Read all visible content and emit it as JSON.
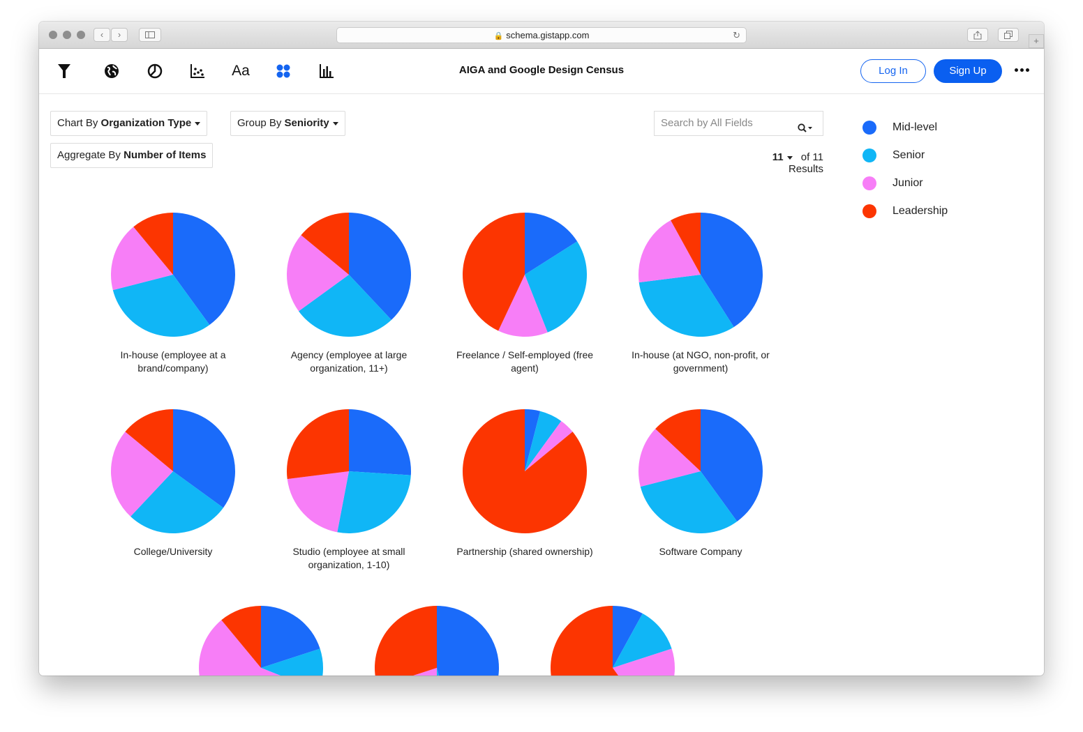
{
  "browser": {
    "url": "schema.gistapp.com"
  },
  "toolbar": {
    "icons": [
      "filter-icon",
      "globe-icon",
      "pie-chart-icon",
      "scatter-icon",
      "text-icon",
      "grid-icon",
      "bar-chart-icon"
    ],
    "text_tool_label": "Aa"
  },
  "app": {
    "title": "AIGA and Google Design Census",
    "login_label": "Log In",
    "signup_label": "Sign Up"
  },
  "controls": {
    "chart_by_prefix": "Chart By",
    "chart_by_value": "Organization Type",
    "group_by_prefix": "Group By",
    "group_by_value": "Seniority",
    "aggregate_prefix": "Aggregate By",
    "aggregate_value": "Number of Items",
    "search_placeholder": "Search by All Fields",
    "results_count": "11",
    "results_text": "of 11 Results"
  },
  "legend": [
    {
      "label": "Mid-level",
      "color": "#1a6bfa"
    },
    {
      "label": "Senior",
      "color": "#10b6f6"
    },
    {
      "label": "Junior",
      "color": "#f77ef7"
    },
    {
      "label": "Leadership",
      "color": "#fc3501"
    }
  ],
  "chart_data": {
    "type": "pie",
    "series_order": [
      "Mid-level",
      "Senior",
      "Junior",
      "Leadership"
    ],
    "unit": "share of items",
    "charts": [
      {
        "label": "In-house (employee at a brand/company)",
        "values": {
          "Mid-level": 0.4,
          "Senior": 0.31,
          "Junior": 0.18,
          "Leadership": 0.11
        }
      },
      {
        "label": "Agency (employee at large organization, 11+)",
        "values": {
          "Mid-level": 0.38,
          "Senior": 0.27,
          "Junior": 0.21,
          "Leadership": 0.14
        }
      },
      {
        "label": "Freelance / Self-employed (free agent)",
        "values": {
          "Mid-level": 0.16,
          "Senior": 0.28,
          "Junior": 0.13,
          "Leadership": 0.43
        }
      },
      {
        "label": "In-house (at NGO, non-profit, or government)",
        "values": {
          "Mid-level": 0.41,
          "Senior": 0.32,
          "Junior": 0.19,
          "Leadership": 0.08
        }
      },
      {
        "label": "College/University",
        "values": {
          "Mid-level": 0.35,
          "Senior": 0.27,
          "Junior": 0.24,
          "Leadership": 0.14
        }
      },
      {
        "label": "Studio (employee at small organization, 1-10)",
        "values": {
          "Mid-level": 0.26,
          "Senior": 0.27,
          "Junior": 0.2,
          "Leadership": 0.27
        }
      },
      {
        "label": "Partnership (shared ownership)",
        "values": {
          "Mid-level": 0.04,
          "Senior": 0.06,
          "Junior": 0.04,
          "Leadership": 0.86
        }
      },
      {
        "label": "Software Company",
        "values": {
          "Mid-level": 0.4,
          "Senior": 0.31,
          "Junior": 0.16,
          "Leadership": 0.13
        }
      },
      {
        "label": "",
        "values": {
          "Mid-level": 0.2,
          "Senior": 0.11,
          "Junior": 0.58,
          "Leadership": 0.11
        }
      },
      {
        "label": "",
        "values": {
          "Mid-level": 0.46,
          "Senior": 0.04,
          "Junior": 0.2,
          "Leadership": 0.3
        }
      },
      {
        "label": "",
        "values": {
          "Mid-level": 0.08,
          "Senior": 0.12,
          "Junior": 0.2,
          "Leadership": 0.6
        }
      }
    ]
  }
}
